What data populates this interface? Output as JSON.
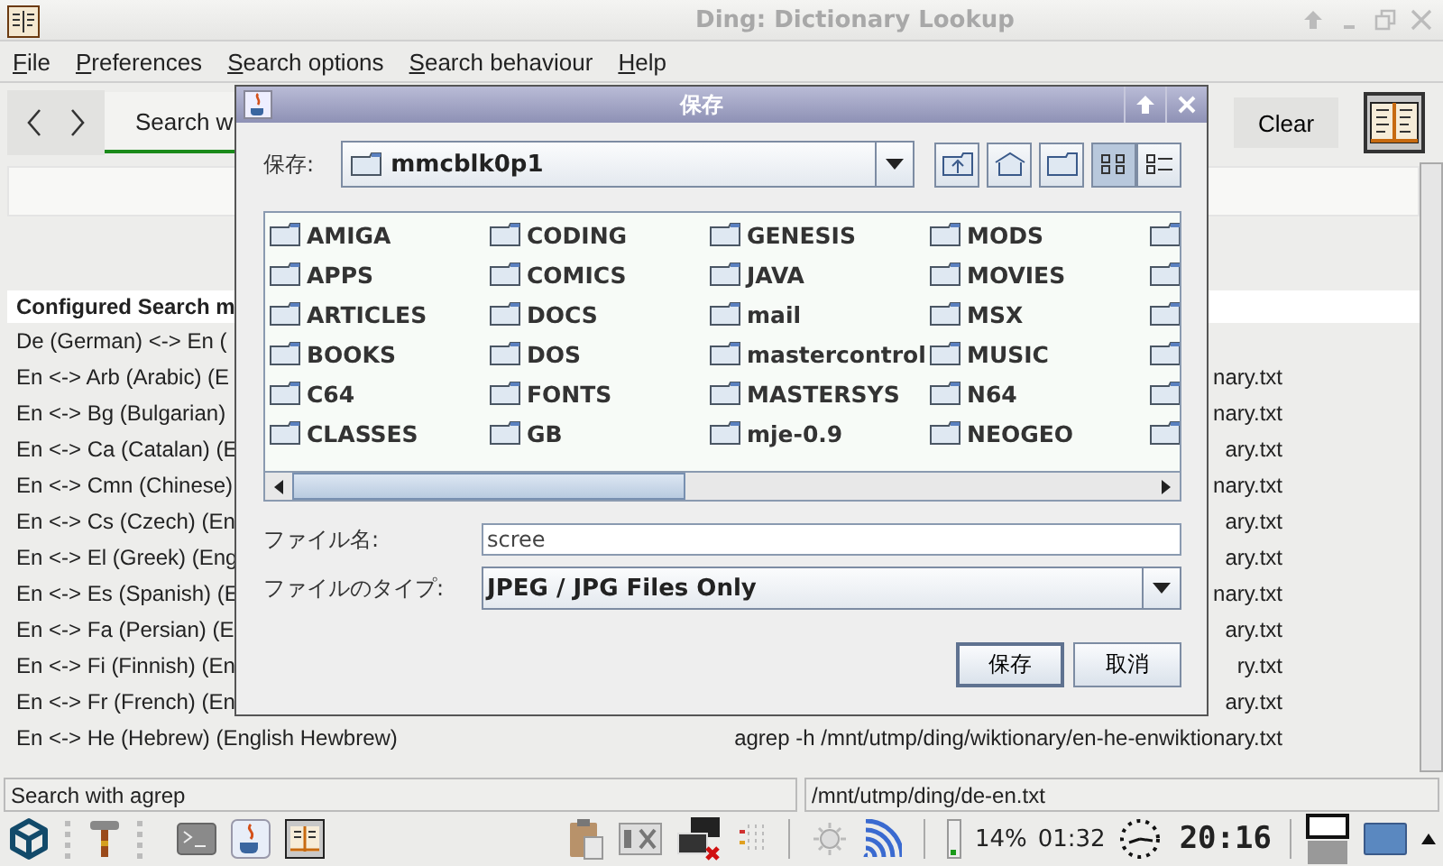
{
  "window": {
    "title": "Ding: Dictionary Lookup"
  },
  "menu": [
    "File",
    "Preferences",
    "Search options",
    "Search behaviour",
    "Help"
  ],
  "toolbar": {
    "tab": "Search w",
    "clear": "Clear"
  },
  "table": {
    "header": "Configured Search m",
    "rows": [
      {
        "name": "De (German) <-> En ("
      },
      {
        "name": "En <-> Arb (Arabic) (E",
        "command": "nary.txt"
      },
      {
        "name": "En <-> Bg (Bulgarian)",
        "command": "nary.txt"
      },
      {
        "name": "En <-> Ca (Catalan) (E",
        "command": "ary.txt"
      },
      {
        "name": "En <-> Cmn (Chinese)",
        "command": "nary.txt"
      },
      {
        "name": "En <-> Cs (Czech) (En",
        "command": "ary.txt"
      },
      {
        "name": "En <-> El (Greek) (Eng",
        "command": "ary.txt"
      },
      {
        "name": "En <-> Es (Spanish) (E",
        "command": "nary.txt"
      },
      {
        "name": "En <-> Fa (Persian) (E",
        "command": "ary.txt"
      },
      {
        "name": "En <-> Fi (Finnish) (En",
        "command": "ry.txt"
      },
      {
        "name": "En <-> Fr (French) (En",
        "command": "ary.txt"
      },
      {
        "name": "En <-> He (Hebrew) (English Hewbrew)",
        "command": "agrep -h /mnt/utmp/ding/wiktionary/en-he-enwiktionary.txt"
      }
    ]
  },
  "dialog": {
    "title": "保存",
    "look_in_label": "保存:",
    "folder": "mmcblk0p1",
    "files": [
      "AMIGA",
      "APPS",
      "ARTICLES",
      "BOOKS",
      "C64",
      "CLASSES",
      "CODING",
      "COMICS",
      "DOCS",
      "DOS",
      "FONTS",
      "GB",
      "GENESIS",
      "JAVA",
      "mail",
      "mastercontrol",
      "MASTERSYS",
      "mje-0.9",
      "MODS",
      "MOVIES",
      "MSX",
      "MUSIC",
      "N64",
      "NEOGEO"
    ],
    "filename_label": "ファイル名:",
    "filename": "scree",
    "filetype_label": "ファイルのタイプ:",
    "filetype": "JPEG / JPG Files Only",
    "buttons": [
      {
        "label": "保存",
        "default": true
      },
      {
        "label": "取消",
        "default": false
      }
    ]
  },
  "status": [
    "Search with agrep",
    "/mnt/utmp/ding/de-en.txt"
  ],
  "taskbar": {
    "battery": "14%",
    "time_left": "01:32",
    "clock": "20:16"
  }
}
